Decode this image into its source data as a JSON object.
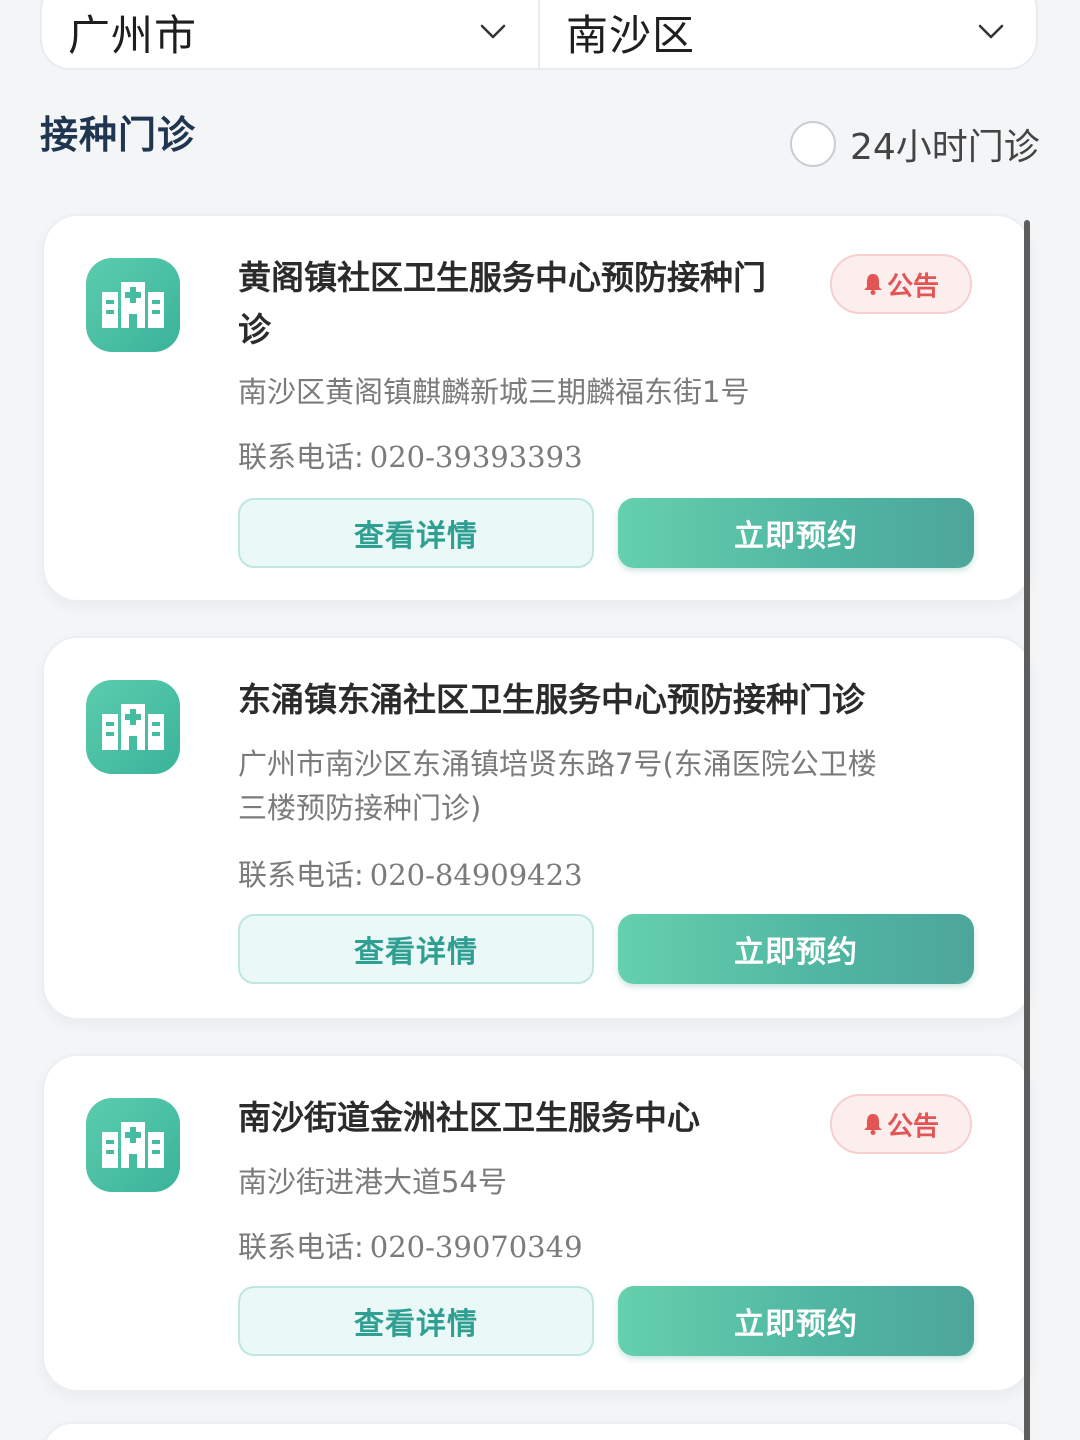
{
  "location": {
    "city": "广州市",
    "district": "南沙区"
  },
  "section": {
    "title": "接种门诊",
    "filter_24h_label": "24小时门诊",
    "filter_24h_checked": false
  },
  "clinics": [
    {
      "name_line1": "黄阁镇社区卫生服务中心预防接种门",
      "name_line2": "诊",
      "has_notice": true,
      "notice_label": "公告",
      "address_line1": "南沙区黄阁镇麒麟新城三期麟福东街1号",
      "address_line2": "",
      "phone_label": "联系电话:",
      "phone": "020-39393393",
      "detail_label": "查看详情",
      "book_label": "立即预约"
    },
    {
      "name_line1": "东涌镇东涌社区卫生服务中心预防接种门诊",
      "name_line2": "",
      "has_notice": false,
      "notice_label": "",
      "address_line1": "广州市南沙区东涌镇培贤东路7号(东涌医院公卫楼",
      "address_line2": "三楼预防接种门诊)",
      "phone_label": "联系电话:",
      "phone": "020-84909423",
      "detail_label": "查看详情",
      "book_label": "立即预约"
    },
    {
      "name_line1": "南沙街道金洲社区卫生服务中心",
      "name_line2": "",
      "has_notice": true,
      "notice_label": "公告",
      "address_line1": "南沙街进港大道54号",
      "address_line2": "",
      "phone_label": "联系电话:",
      "phone": "020-39070349",
      "detail_label": "查看详情",
      "book_label": "立即预约"
    }
  ],
  "colors": {
    "accent": "#4fb5a2",
    "notice": "#e35454",
    "title": "#1f3550"
  },
  "icons": {
    "select": "chevron-down-icon",
    "clinic": "hospital-icon",
    "notice": "bell-icon"
  }
}
